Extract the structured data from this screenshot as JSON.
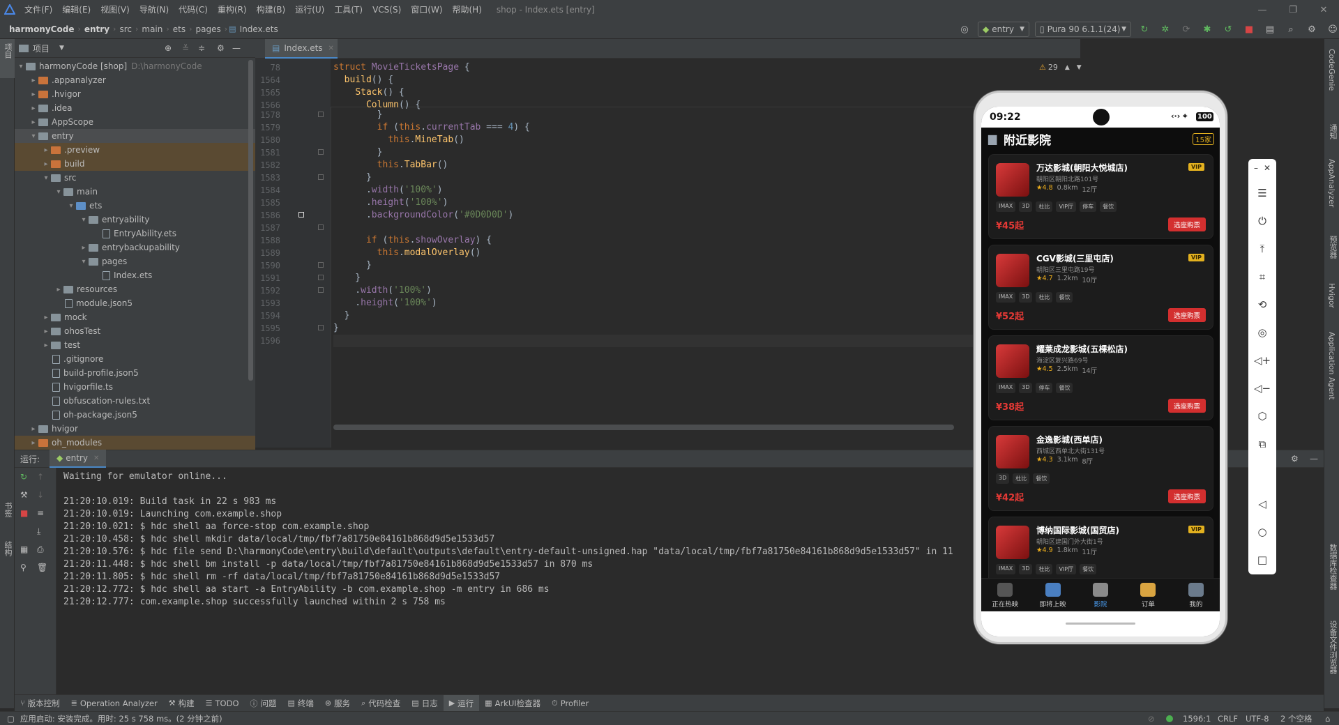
{
  "titlebar": {
    "menus": [
      "文件(F)",
      "编辑(E)",
      "视图(V)",
      "导航(N)",
      "代码(C)",
      "重构(R)",
      "构建(B)",
      "运行(U)",
      "工具(T)",
      "VCS(S)",
      "窗口(W)",
      "帮助(H)"
    ],
    "window_title": "shop - Index.ets [entry]"
  },
  "navbar": {
    "crumbs": [
      "harmonyCode",
      "entry",
      "src",
      "main",
      "ets",
      "pages",
      "Index.ets"
    ],
    "run_config": "entry",
    "device": "Pura 90 6.1.1(24)"
  },
  "left_strip": {
    "project_label": "项目",
    "bookmarks_label": "书签",
    "structure_label": "结构"
  },
  "right_strip": {
    "labels": [
      "CodeGenie",
      "通知",
      "AppAnalyzer",
      "预览器",
      "Hvigor",
      "Application Agent",
      "数据库检查器",
      "设备文件浏览器"
    ]
  },
  "project": {
    "title": "项目",
    "root": {
      "name": "harmonyCode [shop]",
      "path": "D:\\harmonyCode"
    },
    "items": [
      {
        "label": ".appanalyzer"
      },
      {
        "label": ".hvigor"
      },
      {
        "label": ".idea"
      },
      {
        "label": "AppScope"
      },
      {
        "label": "entry"
      },
      {
        "label": ".preview"
      },
      {
        "label": "build"
      },
      {
        "label": "src"
      },
      {
        "label": "main"
      },
      {
        "label": "ets"
      },
      {
        "label": "entryability"
      },
      {
        "label": "EntryAbility.ets"
      },
      {
        "label": "entrybackupability"
      },
      {
        "label": "pages"
      },
      {
        "label": "Index.ets"
      },
      {
        "label": "resources"
      },
      {
        "label": "module.json5"
      },
      {
        "label": "mock"
      },
      {
        "label": "ohosTest"
      },
      {
        "label": "test"
      },
      {
        "label": ".gitignore"
      },
      {
        "label": "build-profile.json5"
      },
      {
        "label": "hvigorfile.ts"
      },
      {
        "label": "obfuscation-rules.txt"
      },
      {
        "label": "oh-package.json5"
      },
      {
        "label": "hvigor"
      },
      {
        "label": "oh_modules"
      }
    ]
  },
  "editor": {
    "tab": "Index.ets",
    "warnings": "29",
    "lines": [
      {
        "n": "78",
        "code": "struct MovieTicketsPage {"
      },
      {
        "n": "1564",
        "code": "  build() {"
      },
      {
        "n": "1565",
        "code": "    Stack() {"
      },
      {
        "n": "1566",
        "code": "      Column() {"
      },
      {
        "n": "1578",
        "code": "        }"
      },
      {
        "n": "1579",
        "code": "        if (this.currentTab === 4) {"
      },
      {
        "n": "1580",
        "code": "          this.MineTab()"
      },
      {
        "n": "1581",
        "code": "        }"
      },
      {
        "n": "1582",
        "code": "        this.TabBar()"
      },
      {
        "n": "1583",
        "code": "      }"
      },
      {
        "n": "1584",
        "code": "      .width('100%')"
      },
      {
        "n": "1585",
        "code": "      .height('100%')"
      },
      {
        "n": "1586",
        "code": "      .backgroundColor('#0D0D0D')"
      },
      {
        "n": "1587",
        "code": ""
      },
      {
        "n": "1588",
        "code": "      if (this.showOverlay) {"
      },
      {
        "n": "1589",
        "code": "        this.modalOverlay()"
      },
      {
        "n": "1590",
        "code": "      }"
      },
      {
        "n": "1591",
        "code": "    }"
      },
      {
        "n": "1592",
        "code": "    .width('100%')"
      },
      {
        "n": "1593",
        "code": "    .height('100%')"
      },
      {
        "n": "1594",
        "code": "  }"
      },
      {
        "n": "1595",
        "code": "}"
      },
      {
        "n": "1596",
        "code": ""
      }
    ]
  },
  "run": {
    "label": "运行:",
    "tab": "entry",
    "console": [
      "Waiting for emulator online...",
      "",
      "21:20:10.019: Build task in 22 s 983 ms",
      "21:20:10.019: Launching com.example.shop",
      "21:20:10.021: $ hdc shell aa force-stop com.example.shop",
      "21:20:10.458: $ hdc shell mkdir data/local/tmp/fbf7a81750e84161b868d9d5e1533d57",
      "21:20:10.576: $ hdc file send D:\\harmonyCode\\entry\\build\\default\\outputs\\default\\entry-default-unsigned.hap \"data/local/tmp/fbf7a81750e84161b868d9d5e1533d57\" in 11",
      "21:20:11.448: $ hdc shell bm install -p data/local/tmp/fbf7a81750e84161b868d9d5e1533d57 in 870 ms",
      "21:20:11.805: $ hdc shell rm -rf data/local/tmp/fbf7a81750e84161b868d9d5e1533d57",
      "21:20:12.772: $ hdc shell aa start -a EntryAbility -b com.example.shop -m entry in 686 ms",
      "21:20:12.777: com.example.shop successfully launched within 2 s 758 ms"
    ]
  },
  "toolwindows": [
    "版本控制",
    "Operation Analyzer",
    "构建",
    "TODO",
    "问题",
    "终端",
    "服务",
    "代码检查",
    "日志",
    "运行",
    "ArkUI检查器",
    "Profiler"
  ],
  "status": {
    "message": "应用启动: 安装完成。用时: 25 s 758 ms。(2 分钟之前)",
    "position": "1596:1",
    "line_sep": "CRLF",
    "encoding": "UTF-8",
    "indent": "2 个空格"
  },
  "phone": {
    "time": "09:22",
    "battery": "100",
    "header_title": "附近影院",
    "header_badge": "15家",
    "cinemas": [
      {
        "name": "万达影城(朝阳大悦城店)",
        "addr": "朝阳区朝阳北路101号",
        "rating": "4.8",
        "dist": "0.8km",
        "halls": "12厅",
        "vip": "VIP",
        "tags": [
          "IMAX",
          "3D",
          "杜比",
          "VIP厅",
          "停车",
          "餐饮"
        ],
        "price": "¥45起",
        "buy": "选座购票"
      },
      {
        "name": "CGV影城(三里屯店)",
        "addr": "朝阳区三里屯路19号",
        "rating": "4.7",
        "dist": "1.2km",
        "halls": "10厅",
        "vip": "VIP",
        "tags": [
          "IMAX",
          "3D",
          "杜比",
          "餐饮"
        ],
        "price": "¥52起",
        "buy": "选座购票"
      },
      {
        "name": "耀莱成龙影城(五棵松店)",
        "addr": "海淀区复兴路69号",
        "rating": "4.5",
        "dist": "2.5km",
        "halls": "14厅",
        "vip": "",
        "tags": [
          "IMAX",
          "3D",
          "停车",
          "餐饮"
        ],
        "price": "¥38起",
        "buy": "选座购票"
      },
      {
        "name": "金逸影城(西单店)",
        "addr": "西城区西单北大街131号",
        "rating": "4.3",
        "dist": "3.1km",
        "halls": "8厅",
        "vip": "",
        "tags": [
          "3D",
          "杜比",
          "餐饮"
        ],
        "price": "¥42起",
        "buy": "选座购票"
      },
      {
        "name": "博纳国际影城(国贸店)",
        "addr": "朝阳区建国门外大街1号",
        "rating": "4.9",
        "dist": "1.8km",
        "halls": "11厅",
        "vip": "VIP",
        "tags": [
          "IMAX",
          "3D",
          "杜比",
          "VIP厅",
          "餐饮"
        ],
        "price": "",
        "buy": ""
      }
    ],
    "tabs": [
      {
        "label": "正在热映",
        "color": "#555555"
      },
      {
        "label": "即将上映",
        "color": "#4a7fc1"
      },
      {
        "label": "影院",
        "color": "#8a8a8a"
      },
      {
        "label": "订单",
        "color": "#d9a441"
      },
      {
        "label": "我的",
        "color": "#6b7b8c"
      }
    ],
    "active_tab_color": "#4a9ff5"
  }
}
